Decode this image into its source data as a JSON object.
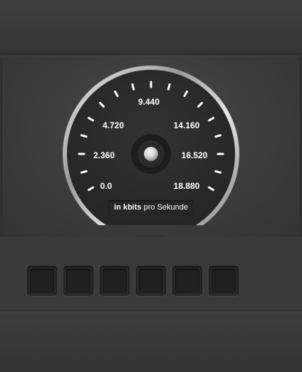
{
  "gauge": {
    "scale_labels": [
      "0.0",
      "2.360",
      "4.720",
      "9.440",
      "14.160",
      "16.520",
      "18.880"
    ],
    "unit": {
      "bold": "in kbits",
      "normal": "pro Sekunde"
    }
  },
  "digit_display": {
    "slots": 6
  },
  "colors": {
    "background": "#3a3a3a",
    "dial": "#2b2b2b",
    "text": "#ffffff"
  }
}
